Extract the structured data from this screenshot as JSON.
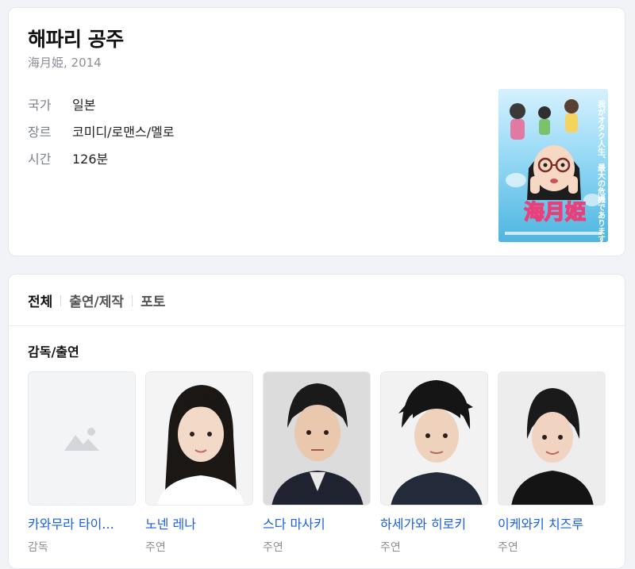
{
  "movie": {
    "title": "해파리 공주",
    "subtitle": "海月姫, 2014",
    "info": [
      {
        "key": "국가",
        "value": "일본"
      },
      {
        "key": "장르",
        "value": "코미디/로맨스/멜로"
      },
      {
        "key": "시간",
        "value": "126분"
      }
    ],
    "poster": {
      "caption_main": "海月姫",
      "caption_side": "我がオタク人生、最大の危機であります!!"
    }
  },
  "tabs": [
    {
      "label": "전체",
      "active": true
    },
    {
      "label": "출연/제작",
      "active": false
    },
    {
      "label": "포토",
      "active": false
    }
  ],
  "cast_section": {
    "heading": "감독/출연",
    "people": [
      {
        "name": "카와무라 타이...",
        "role": "감독",
        "photo": "placeholder"
      },
      {
        "name": "노넨 레나",
        "role": "주연",
        "photo": "photo"
      },
      {
        "name": "스다 마사키",
        "role": "주연",
        "photo": "photo"
      },
      {
        "name": "하세가와 히로키",
        "role": "주연",
        "photo": "photo"
      },
      {
        "name": "이케와키 치즈루",
        "role": "주연",
        "photo": "photo"
      }
    ]
  },
  "colors": {
    "link": "#1a5ee6",
    "muted": "#8a8f96",
    "background": "#f1f3f6"
  }
}
